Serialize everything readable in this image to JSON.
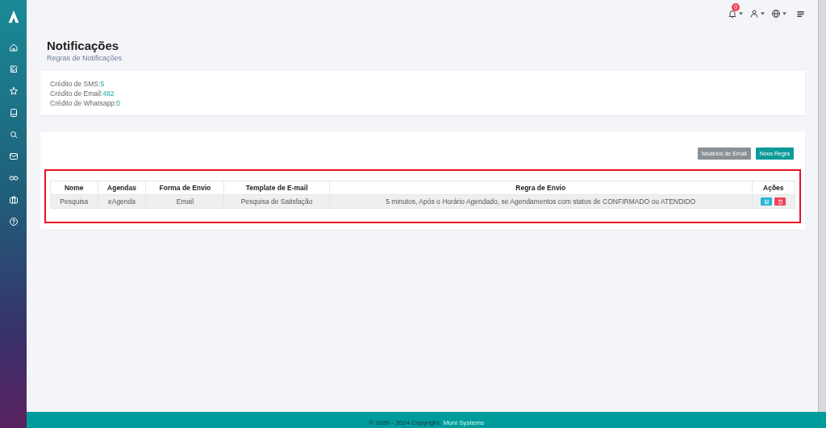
{
  "header": {
    "notification_count": "0"
  },
  "page": {
    "title": "Notificações",
    "subtitle": "Regras de Notificações"
  },
  "credits": [
    {
      "label": "Crédito de SMS:",
      "value": "5"
    },
    {
      "label": "Crédito de Email:",
      "value": "482"
    },
    {
      "label": "Crédito de Whatsapp:",
      "value": "0"
    }
  ],
  "buttons": [
    {
      "label": "Modelos de Email",
      "kind": "secondary"
    },
    {
      "label": "Nova Regra",
      "kind": "primary"
    }
  ],
  "table": {
    "columns": [
      "Nome",
      "Agendas",
      "Forma de Envio",
      "Template de E-mail",
      "Regra de Envio",
      "Ações"
    ],
    "rows": [
      {
        "cells": [
          "Pesquisa",
          "eAgenda",
          "Email",
          "Pesquisa de Satisfação",
          "5 minutos, Após o Horário Agendado, se Agendamentos com status de CONFIRMADO ou ATENDIDO"
        ]
      }
    ]
  },
  "footer": {
    "text": "© 2020 - 2024 Copyright:",
    "link": "Muni Systems"
  }
}
